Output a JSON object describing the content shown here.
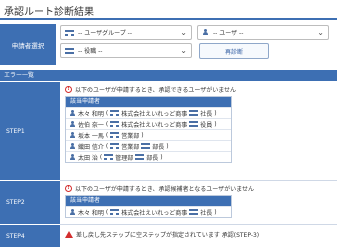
{
  "header": {
    "title": "承認ルート診断結果"
  },
  "selector": {
    "label": "申請者選択",
    "group_dropdown": "-- ユーザグループ --",
    "user_dropdown": "-- ユーザ --",
    "post_dropdown": "-- 役職 --",
    "rediagnose_button": "再診断"
  },
  "errors": {
    "section_title": "エラー一覧",
    "step1": {
      "label": "STEP1",
      "message": "以下のユーザが申請するとき、承認できるユーザがいません",
      "table_header": "該当申請者",
      "rows": [
        {
          "name": "木々 和明",
          "org": "株式会社えいれっど商事",
          "post": "社長"
        },
        {
          "name": "佐伯 奈一",
          "org": "株式会社えいれっど商事",
          "post": "役員"
        },
        {
          "name": "坂本 一馬",
          "org": "営業部",
          "post": ""
        },
        {
          "name": "織田 信介",
          "org": "営業部",
          "post": "部長"
        },
        {
          "name": "太田 治",
          "org": "管理部",
          "post": "部長"
        }
      ]
    },
    "step2": {
      "label": "STEP2",
      "message": "以下のユーザが申請するとき、承認候補者となるユーザがいません",
      "table_header": "該当申請者",
      "rows": [
        {
          "name": "木々 和明",
          "org": "株式会社えいれっど商事",
          "post": "社長"
        }
      ]
    },
    "step4": {
      "label": "STEP4",
      "message": "差し戻し先ステップに空ステップが指定されています 承認(STEP-3)"
    }
  },
  "colors": {
    "accent": "#3d6fb3",
    "error": "#d32f2f"
  }
}
